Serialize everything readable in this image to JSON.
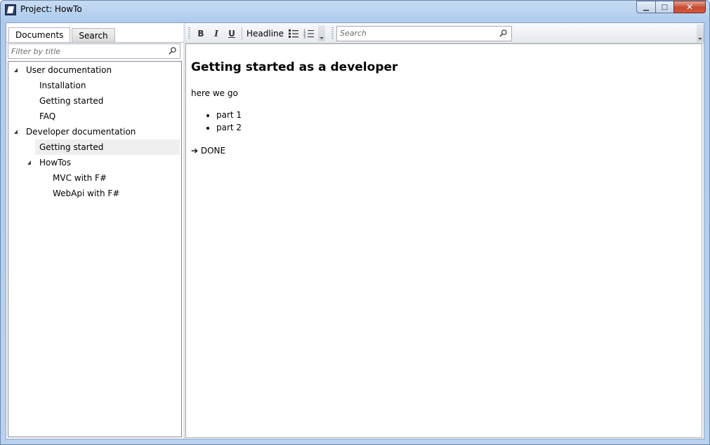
{
  "window": {
    "title": "Project: HowTo",
    "min_glyph": "▁",
    "max_glyph": "□",
    "close_glyph": "✕"
  },
  "sidebar": {
    "tabs": [
      {
        "label": "Documents",
        "active": true
      },
      {
        "label": "Search",
        "active": false
      }
    ],
    "filter_placeholder": "Filter by title",
    "tree": [
      {
        "label": "User documentation",
        "level": 0,
        "expanded": true
      },
      {
        "label": "Installation",
        "level": 1
      },
      {
        "label": "Getting started",
        "level": 1
      },
      {
        "label": "FAQ",
        "level": 1
      },
      {
        "label": "Developer documentation",
        "level": 0,
        "expanded": true
      },
      {
        "label": "Getting started",
        "level": 1,
        "selected": true
      },
      {
        "label": "HowTos",
        "level": 1,
        "expanded": true
      },
      {
        "label": "MVC with F#",
        "level": 2
      },
      {
        "label": "WebApi with F#",
        "level": 2
      }
    ]
  },
  "toolbar": {
    "bold_label": "B",
    "italic_label": "I",
    "underline_label": "U",
    "headline_label": "Headline",
    "search_placeholder": "Search"
  },
  "document": {
    "heading": "Getting started as a developer",
    "paragraph": "here we go",
    "list": [
      "part 1",
      "part 2"
    ],
    "done_text": "➔ DONE"
  }
}
